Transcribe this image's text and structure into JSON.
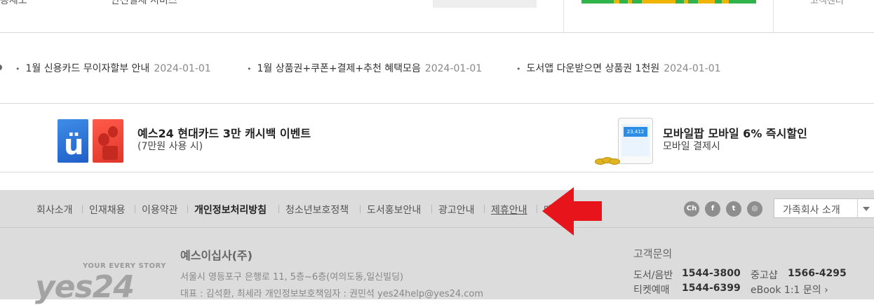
{
  "top": {
    "cut_left": "송제도",
    "cut_mid": "안전결제 서비스",
    "cut_right": "고객센터"
  },
  "notices": [
    {
      "title": "1월 신용카드 무이자할부 안내",
      "date": "2024-01-01"
    },
    {
      "title": "1월 상품권+쿠폰+결제+추천 혜택모음",
      "date": "2024-01-01"
    },
    {
      "title": "도서앱 다운받으면 상품권 1천원",
      "date": "2024-01-01"
    }
  ],
  "banners": [
    {
      "title": "예스24 현대카드 3만 캐시백 이벤트",
      "subtitle": "(7만원 사용 시)"
    },
    {
      "title": "모바일팝 모바일 6% 즉시할인",
      "subtitle": "모바일 결제시"
    }
  ],
  "phone_screen_value": "23,412",
  "footer_nav": {
    "items": [
      "회사소개",
      "인재채용",
      "이용약관",
      "개인정보처리방침",
      "청소년보호정책",
      "도서홍보안내",
      "광고안내",
      "제휴안내",
      "매장안내"
    ],
    "sns": [
      "channel-icon",
      "facebook-icon",
      "twitter-icon",
      "instagram-icon"
    ],
    "sns_labels": [
      "Ch",
      "f",
      "t",
      "◎"
    ],
    "family_select": "가족회사 소개"
  },
  "annotation": {
    "arrow_color": "#e8141b"
  },
  "company": {
    "logo_tagline": "YOUR EVERY STORY",
    "logo_word": "yes24",
    "name": "예스이십사(주)",
    "address": "서울시 영등포구 은행로 11, 5층~6층(여의도동,일신빌딩)",
    "reps": "대표 : 김석환, 최세라    개인정보보호책임자 : 권민석 yes24help@yes24.com"
  },
  "customer_service": {
    "heading": "고객문의",
    "rows": [
      {
        "label": "도서/음반",
        "number": "1544-3800",
        "label2": "중고샵",
        "number2": "1566-4295"
      },
      {
        "label": "티켓예매",
        "number": "1544-6399",
        "label2": "eBook 1:1 문의 ›",
        "number2": ""
      }
    ]
  }
}
